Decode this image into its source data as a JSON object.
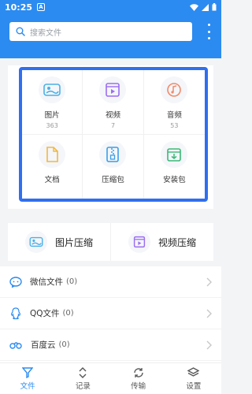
{
  "status_bar": {
    "time": "10:25",
    "badge": "A"
  },
  "search": {
    "placeholder": "搜索文件"
  },
  "categories": [
    {
      "label": "图片",
      "count": "363",
      "icon": "image-icon"
    },
    {
      "label": "视频",
      "count": "7",
      "icon": "video-icon"
    },
    {
      "label": "音频",
      "count": "53",
      "icon": "music-icon"
    },
    {
      "label": "文档",
      "count": "",
      "icon": "document-icon"
    },
    {
      "label": "压缩包",
      "count": "",
      "icon": "zip-icon"
    },
    {
      "label": "安装包",
      "count": "",
      "icon": "install-package-icon"
    }
  ],
  "compress": {
    "image": "图片压缩",
    "video": "视频压缩"
  },
  "list": [
    {
      "label": "微信文件",
      "count": "(0)",
      "icon": "wechat-icon"
    },
    {
      "label": "QQ文件",
      "count": "(0)",
      "icon": "qq-icon"
    },
    {
      "label": "百度云",
      "count": "(0)",
      "icon": "baidu-cloud-icon"
    }
  ],
  "tabs": [
    {
      "label": "文件",
      "icon": "file-filter-icon",
      "active": true
    },
    {
      "label": "记录",
      "icon": "record-icon",
      "active": false
    },
    {
      "label": "传输",
      "icon": "transfer-icon",
      "active": false
    },
    {
      "label": "设置",
      "icon": "settings-layers-icon",
      "active": false
    }
  ],
  "colors": {
    "primary": "#2b8bf0",
    "highlight_border": "#2f6ff0"
  }
}
